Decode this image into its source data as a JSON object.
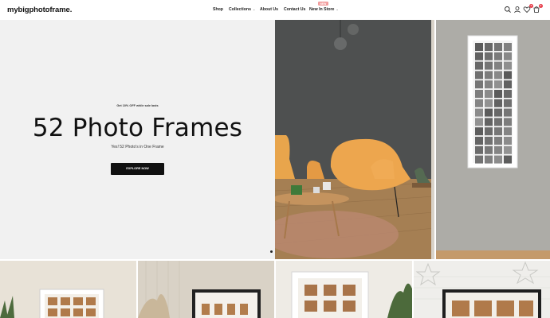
{
  "header": {
    "logo": "mybigphotoframe.",
    "nav": [
      {
        "label": "Shop",
        "has_dropdown": false
      },
      {
        "label": "Collections",
        "has_dropdown": true
      },
      {
        "label": "About Us",
        "has_dropdown": false
      },
      {
        "label": "Contact Us",
        "has_dropdown": false
      },
      {
        "label": "New In Store",
        "has_dropdown": true,
        "badge": "NEW"
      }
    ],
    "icons": [
      "search-icon",
      "account-icon",
      "wishlist-icon",
      "cart-icon"
    ],
    "wishlist_count": "0",
    "cart_count": "0"
  },
  "hero": {
    "promo": "Get 10% OFF while sale lasts",
    "title": "52 Photo Frames",
    "subtitle": "Yes! 52 Photo's in One Frame",
    "cta": "EXPLORE NOW"
  },
  "colors": {
    "accent_badge": "#f29b9b",
    "count_badge": "#e63946",
    "cta_bg": "#111111"
  }
}
